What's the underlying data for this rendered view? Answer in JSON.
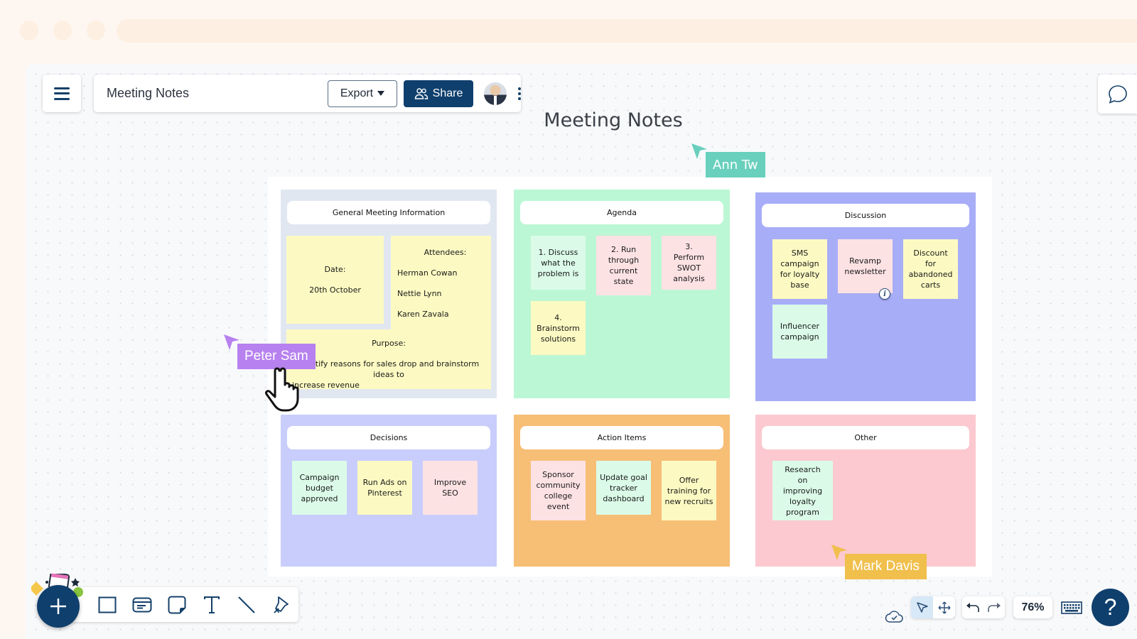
{
  "app": {
    "document_title": "Meeting Notes",
    "export_label": "Export",
    "share_label": "Share",
    "zoom_level": "76%",
    "help_label": "?"
  },
  "board": {
    "title": "Meeting Notes",
    "sections": {
      "general": {
        "header": "General Meeting Information",
        "date_label": "Date:",
        "date_value": "20th October",
        "attendees_label": "Attendees:",
        "attendees": [
          "Herman Cowan",
          "Nettie Lynn",
          "Karen Zavala"
        ],
        "purpose_label": "Purpose:",
        "purpose_line1": "Identify reasons for sales drop and brainstorm ideas to",
        "purpose_line2": "increase revenue",
        "color": "#e1e7f1"
      },
      "agenda": {
        "header": "Agenda",
        "color": "#bbf7d4",
        "notes": [
          {
            "text": "1. Discuss what the problem is",
            "color": "mint"
          },
          {
            "text": "2. Run through current state",
            "color": "pink"
          },
          {
            "text": "3. Perform SWOT analysis",
            "color": "pink"
          },
          {
            "text": "4. Brainstorm solutions",
            "color": "yellow"
          }
        ]
      },
      "discussion": {
        "header": "Discussion",
        "color": "#a8adf8",
        "notes": [
          {
            "text": "SMS campaign for loyalty base",
            "color": "yellow"
          },
          {
            "text": "Revamp newsletter",
            "color": "pink"
          },
          {
            "text": "Discount for abandoned carts",
            "color": "yellow"
          },
          {
            "text": "Influencer campaign",
            "color": "mint"
          }
        ]
      },
      "decisions": {
        "header": "Decisions",
        "color": "#c8cdfc",
        "notes": [
          {
            "text": "Campaign budget approved",
            "color": "mint"
          },
          {
            "text": "Run Ads on Pinterest",
            "color": "yellow"
          },
          {
            "text": "Improve SEO",
            "color": "pink"
          }
        ]
      },
      "action_items": {
        "header": "Action Items",
        "color": "#f7be76",
        "notes": [
          {
            "text": "Sponsor community college event",
            "color": "pink"
          },
          {
            "text": "Update goal tracker dashboard",
            "color": "mint"
          },
          {
            "text": "Offer training for new recruits",
            "color": "yellow"
          }
        ]
      },
      "other": {
        "header": "Other",
        "color": "#fbc9cf",
        "notes": [
          {
            "text": "Research on improving loyalty program",
            "color": "mint"
          }
        ]
      }
    }
  },
  "collaborators": [
    {
      "name": "Ann Tw",
      "color": "#69d0bd"
    },
    {
      "name": "Peter Sam",
      "color": "#b781ef"
    },
    {
      "name": "Mark Davis",
      "color": "#f0bf4c"
    }
  ],
  "icons": {
    "menu": "hamburger-icon",
    "share": "users-icon",
    "more": "kebab-icon",
    "chat": "chat-bubble-icon",
    "add": "plus-icon",
    "tools": [
      "rectangle-icon",
      "card-icon",
      "sticky-note-icon",
      "text-icon",
      "line-icon",
      "pen-icon"
    ],
    "status": "cloud-saved-icon",
    "select": "pointer-icon",
    "pan": "move-icon",
    "undo": "undo-icon",
    "redo": "redo-icon",
    "keyboard": "keyboard-icon"
  }
}
